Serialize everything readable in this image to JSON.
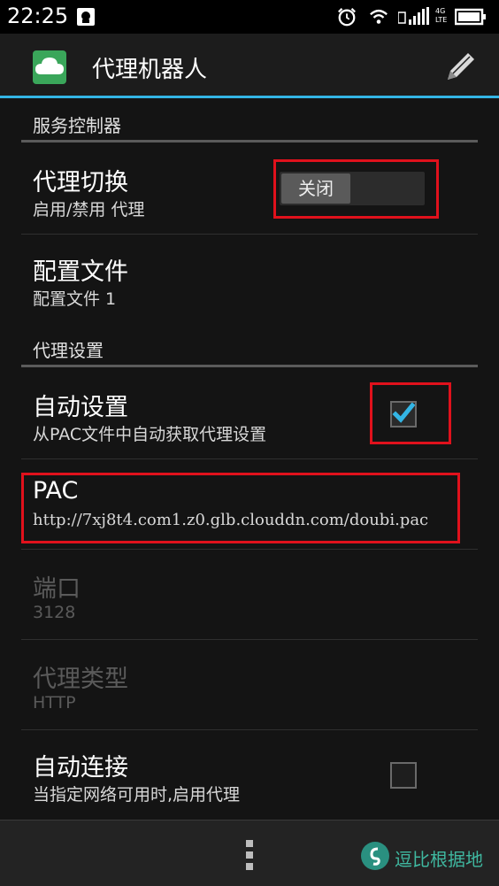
{
  "status_bar": {
    "time": "22:25",
    "network": "4G LTE"
  },
  "app": {
    "title": "代理机器人"
  },
  "sections": {
    "service": "服务控制器",
    "proxy": "代理设置"
  },
  "prefs": {
    "proxy_switch": {
      "title": "代理切换",
      "summary": "启用/禁用 代理",
      "toggle_label": "关闭"
    },
    "profile": {
      "title": "配置文件",
      "summary": "配置文件 1"
    },
    "auto_setting": {
      "title": "自动设置",
      "summary": "从PAC文件中自动获取代理设置",
      "checked": true
    },
    "pac": {
      "title": "PAC",
      "summary": "http://7xj8t4.com1.z0.glb.clouddn.com/doubi.pac"
    },
    "port": {
      "title": "端口",
      "summary": "3128"
    },
    "proxy_type": {
      "title": "代理类型",
      "summary": "HTTP"
    },
    "auto_connect": {
      "title": "自动连接",
      "summary": "当指定网络可用时,启用代理",
      "checked": false
    }
  },
  "watermark": {
    "text": "逗比根据地"
  },
  "colors": {
    "accent": "#33b5e5",
    "highlight": "#e0111c",
    "app_icon": "#3aa65a",
    "watermark": "#3fb8a0"
  }
}
